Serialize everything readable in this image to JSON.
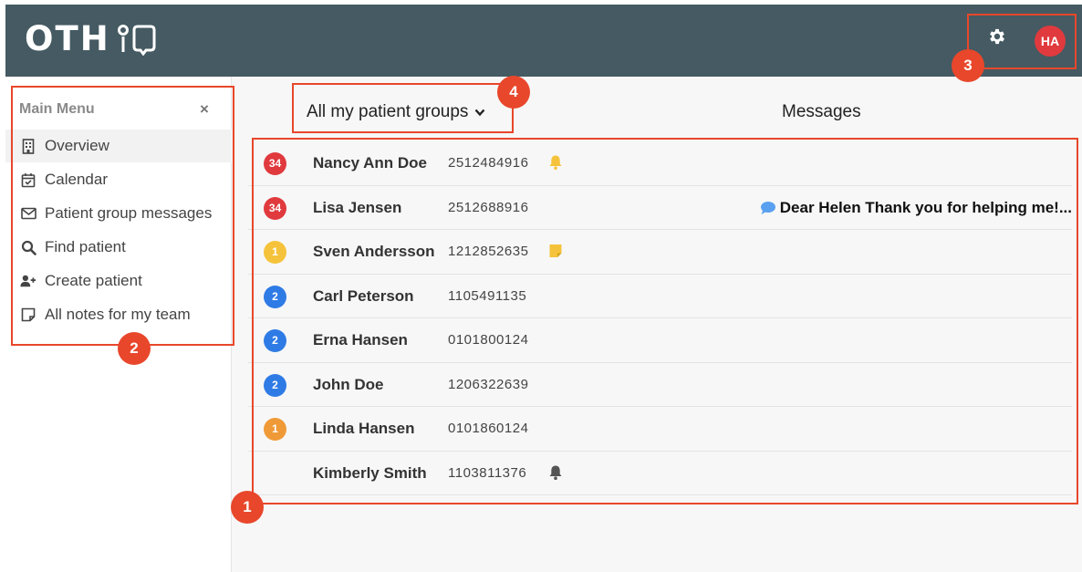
{
  "app": {
    "logo_text": "OTH"
  },
  "header": {
    "user_initials": "HA",
    "avatar_color": "#e03a3e",
    "settings_icon": "gear-icon"
  },
  "sidebar": {
    "title": "Main Menu",
    "close_label": "×",
    "items": [
      {
        "label": "Overview",
        "icon": "building-icon",
        "active": true
      },
      {
        "label": "Calendar",
        "icon": "calendar-check-icon"
      },
      {
        "label": "Patient group messages",
        "icon": "envelope-icon"
      },
      {
        "label": "Find patient",
        "icon": "search-icon"
      },
      {
        "label": "Create patient",
        "icon": "user-plus-icon"
      },
      {
        "label": "All notes for my team",
        "icon": "note-icon"
      }
    ]
  },
  "main": {
    "group_selector": "All my patient groups",
    "messages_header": "Messages",
    "patients": [
      {
        "badge": "34",
        "badge_color": "#e03a3e",
        "name": "Nancy Ann Doe",
        "id": "2512484916",
        "icon": "bell-icon",
        "icon_color": "#f5c33b",
        "message": ""
      },
      {
        "badge": "34",
        "badge_color": "#e03a3e",
        "name": "Lisa Jensen",
        "id": "2512688916",
        "icon": "",
        "message": "Dear Helen Thank you for helping me!..."
      },
      {
        "badge": "1",
        "badge_color": "#f5c33b",
        "name": "Sven Andersson",
        "id": "1212852635",
        "icon": "sticky-note-icon",
        "icon_color": "#f5c33b",
        "message": ""
      },
      {
        "badge": "2",
        "badge_color": "#2f7be5",
        "name": "Carl Peterson",
        "id": "1105491135",
        "icon": "",
        "message": ""
      },
      {
        "badge": "2",
        "badge_color": "#2f7be5",
        "name": "Erna Hansen",
        "id": "0101800124",
        "icon": "",
        "message": ""
      },
      {
        "badge": "2",
        "badge_color": "#2f7be5",
        "name": "John Doe",
        "id": "1206322639",
        "icon": "",
        "message": ""
      },
      {
        "badge": "1",
        "badge_color": "#ef9a37",
        "name": "Linda Hansen",
        "id": "0101860124",
        "icon": "",
        "message": ""
      },
      {
        "badge": "",
        "name": "Kimberly Smith",
        "id": "1103811376",
        "icon": "bell-icon",
        "icon_color": "#555555",
        "message": ""
      }
    ]
  },
  "annotations": {
    "color": "#e8472b",
    "markers": [
      "1",
      "2",
      "3",
      "4"
    ]
  }
}
